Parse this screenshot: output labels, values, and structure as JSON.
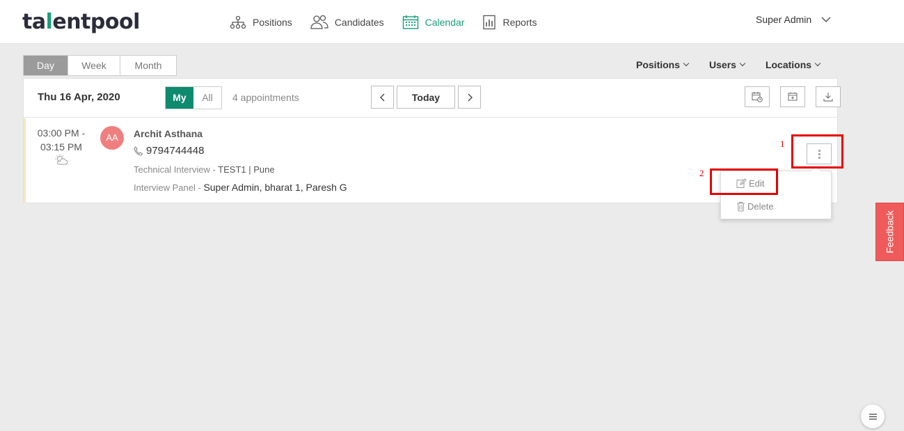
{
  "brand": {
    "logo_left": "ta",
    "logo_accent": "l",
    "logo_right": "entpool"
  },
  "nav": {
    "items": [
      {
        "label": "Positions",
        "icon": "org-chart-icon"
      },
      {
        "label": "Candidates",
        "icon": "people-icon"
      },
      {
        "label": "Calendar",
        "icon": "calendar-icon",
        "active": true
      },
      {
        "label": "Reports",
        "icon": "report-icon"
      }
    ]
  },
  "user": {
    "name": "Super Admin"
  },
  "view_tabs": [
    {
      "label": "Day",
      "active": true
    },
    {
      "label": "Week"
    },
    {
      "label": "Month"
    }
  ],
  "filters": [
    {
      "label": "Positions"
    },
    {
      "label": "Users"
    },
    {
      "label": "Locations"
    }
  ],
  "panel": {
    "date": "Thu 16 Apr, 2020",
    "scope_my": "My",
    "scope_all": "All",
    "appointment_count": "4 appointments",
    "today_label": "Today"
  },
  "appointment": {
    "time_start": "03:00 PM -",
    "time_end": "03:15 PM",
    "avatar_initials": "AA",
    "candidate_name": "Archit Asthana",
    "phone": "9794744448",
    "round_label": "Technical Interview - ",
    "round_value": "TEST1 | Pune",
    "panel_label": "Interview Panel - ",
    "panel_value": "Super Admin, bharat 1, Paresh G"
  },
  "dropdown": {
    "edit_label": "Edit",
    "delete_label": "Delete"
  },
  "annotations": {
    "first": "1",
    "second": "2"
  },
  "feedback_label": "Feedback",
  "colors": {
    "accent": "#1a9c7b",
    "scope_active": "#0e8a6f",
    "avatar": "#ef7f7f",
    "feedback": "#ef5b5b",
    "annotation": "#e60000"
  }
}
